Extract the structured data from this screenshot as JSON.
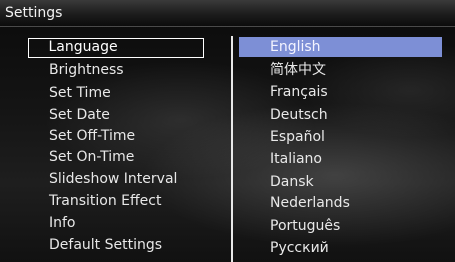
{
  "header": {
    "title": "Settings"
  },
  "menu": {
    "items": [
      {
        "label": "Language"
      },
      {
        "label": "Brightness"
      },
      {
        "label": "Set Time"
      },
      {
        "label": "Set Date"
      },
      {
        "label": "Set Off-Time"
      },
      {
        "label": "Set On-Time"
      },
      {
        "label": "Slideshow Interval"
      },
      {
        "label": "Transition Effect"
      },
      {
        "label": "Info"
      },
      {
        "label": "Default Settings"
      }
    ]
  },
  "options": {
    "items": [
      {
        "label": "English"
      },
      {
        "label": "简体中文"
      },
      {
        "label": "Français"
      },
      {
        "label": "Deutsch"
      },
      {
        "label": "Español"
      },
      {
        "label": "Italiano"
      },
      {
        "label": "Dansk"
      },
      {
        "label": "Nederlands"
      },
      {
        "label": "Português"
      },
      {
        "label": "Русский"
      }
    ]
  },
  "colors": {
    "selection_highlight": "#7d8fd6",
    "focus_border": "#ffffff"
  }
}
